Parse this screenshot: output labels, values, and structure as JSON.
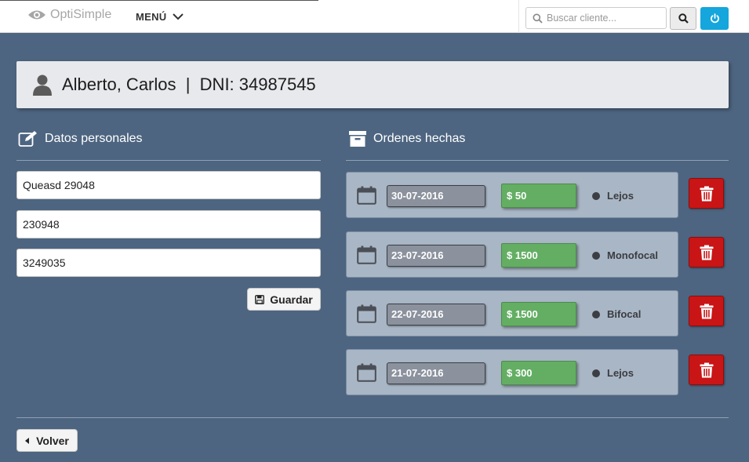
{
  "navbar": {
    "brand": "OptiSimple",
    "menu_label": "MENÚ",
    "search_placeholder": "Buscar cliente..."
  },
  "client": {
    "header": "Alberto, Carlos  |  DNI: 34987545"
  },
  "personal": {
    "title": "Datos personales",
    "fields": [
      "Queasd 29048",
      "230948",
      "3249035"
    ],
    "save_label": "Guardar"
  },
  "orders": {
    "title": "Ordenes hechas",
    "items": [
      {
        "date": "30-07-2016",
        "price": "$ 50",
        "type": "Lejos"
      },
      {
        "date": "23-07-2016",
        "price": "$ 1500",
        "type": "Monofocal"
      },
      {
        "date": "22-07-2016",
        "price": "$ 1500",
        "type": "Bifocal"
      },
      {
        "date": "21-07-2016",
        "price": "$ 300",
        "type": "Lejos"
      }
    ]
  },
  "footer": {
    "back_label": "Volver"
  },
  "colors": {
    "background": "#4d6580",
    "accent": "#14a6dc",
    "price": "#64ae64",
    "delete": "#c91515"
  },
  "icons": [
    "eye-icon",
    "chevron-down-icon",
    "search-icon",
    "power-icon",
    "user-icon",
    "edit-icon",
    "archive-icon",
    "save-icon",
    "calendar-icon",
    "trash-icon",
    "caret-left-icon"
  ]
}
